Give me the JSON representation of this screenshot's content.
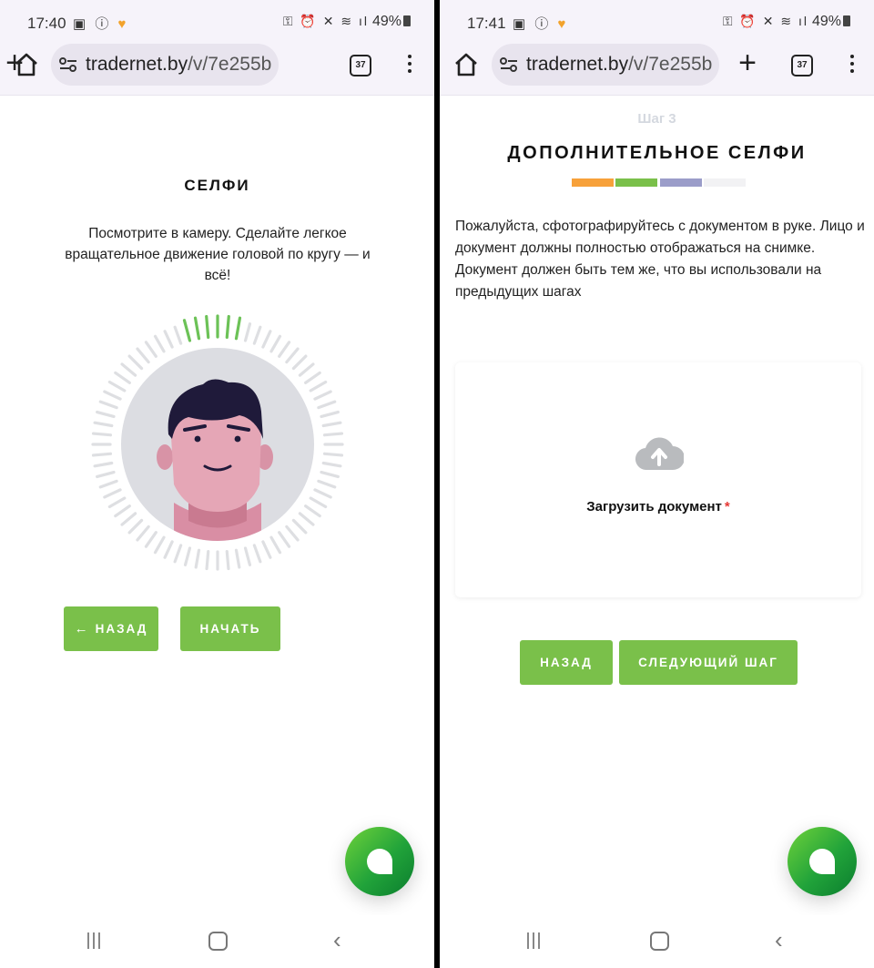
{
  "screens": [
    {
      "status": {
        "time": "17:40",
        "battery": "49%"
      },
      "browser": {
        "url_domain": "tradernet.by",
        "url_path": "/v/7e255b",
        "tab_count": "37"
      },
      "page": {
        "title": "СЕЛФИ",
        "description": "Посмотрите в камеру. Сделайте легкое вращательное движение головой по кругу — и всё!",
        "rotation_progress_fraction": 0.1,
        "back_button": "НАЗАД",
        "start_button": "НАЧАТЬ"
      }
    },
    {
      "status": {
        "time": "17:41",
        "battery": "49%"
      },
      "browser": {
        "url_domain": "tradernet.by",
        "url_path": "/v/7e255b",
        "tab_count": "37"
      },
      "page": {
        "step_label": "Шаг 3",
        "title": "ДОПОЛНИТЕЛЬНОЕ СЕЛФИ",
        "progress_steps": [
          {
            "color": "#f7a13a"
          },
          {
            "color": "#7ac04a"
          },
          {
            "color": "#9b9dc9"
          },
          {
            "color": "#f2f2f4"
          }
        ],
        "description": "Пожалуйста, сфотографируйтесь с документом в руке. Лицо и документ должны полностью отображаться на снимке. Документ должен быть тем же, что вы использовали на предыдущих шагах",
        "upload_label": "Загрузить документ",
        "required_mark": "*",
        "back_button": "НАЗАД",
        "next_button": "СЛЕДУЮЩИЙ ШАГ"
      }
    }
  ],
  "colors": {
    "accent_green": "#7ac04a",
    "required_red": "#e53935"
  },
  "icons": [
    "home-icon",
    "tune-icon",
    "plus-icon",
    "tabs-icon",
    "menu-icon",
    "arrow-left-icon",
    "cloud-upload-icon",
    "chat-icon",
    "recents-icon",
    "nav-home-icon",
    "nav-back-icon"
  ]
}
